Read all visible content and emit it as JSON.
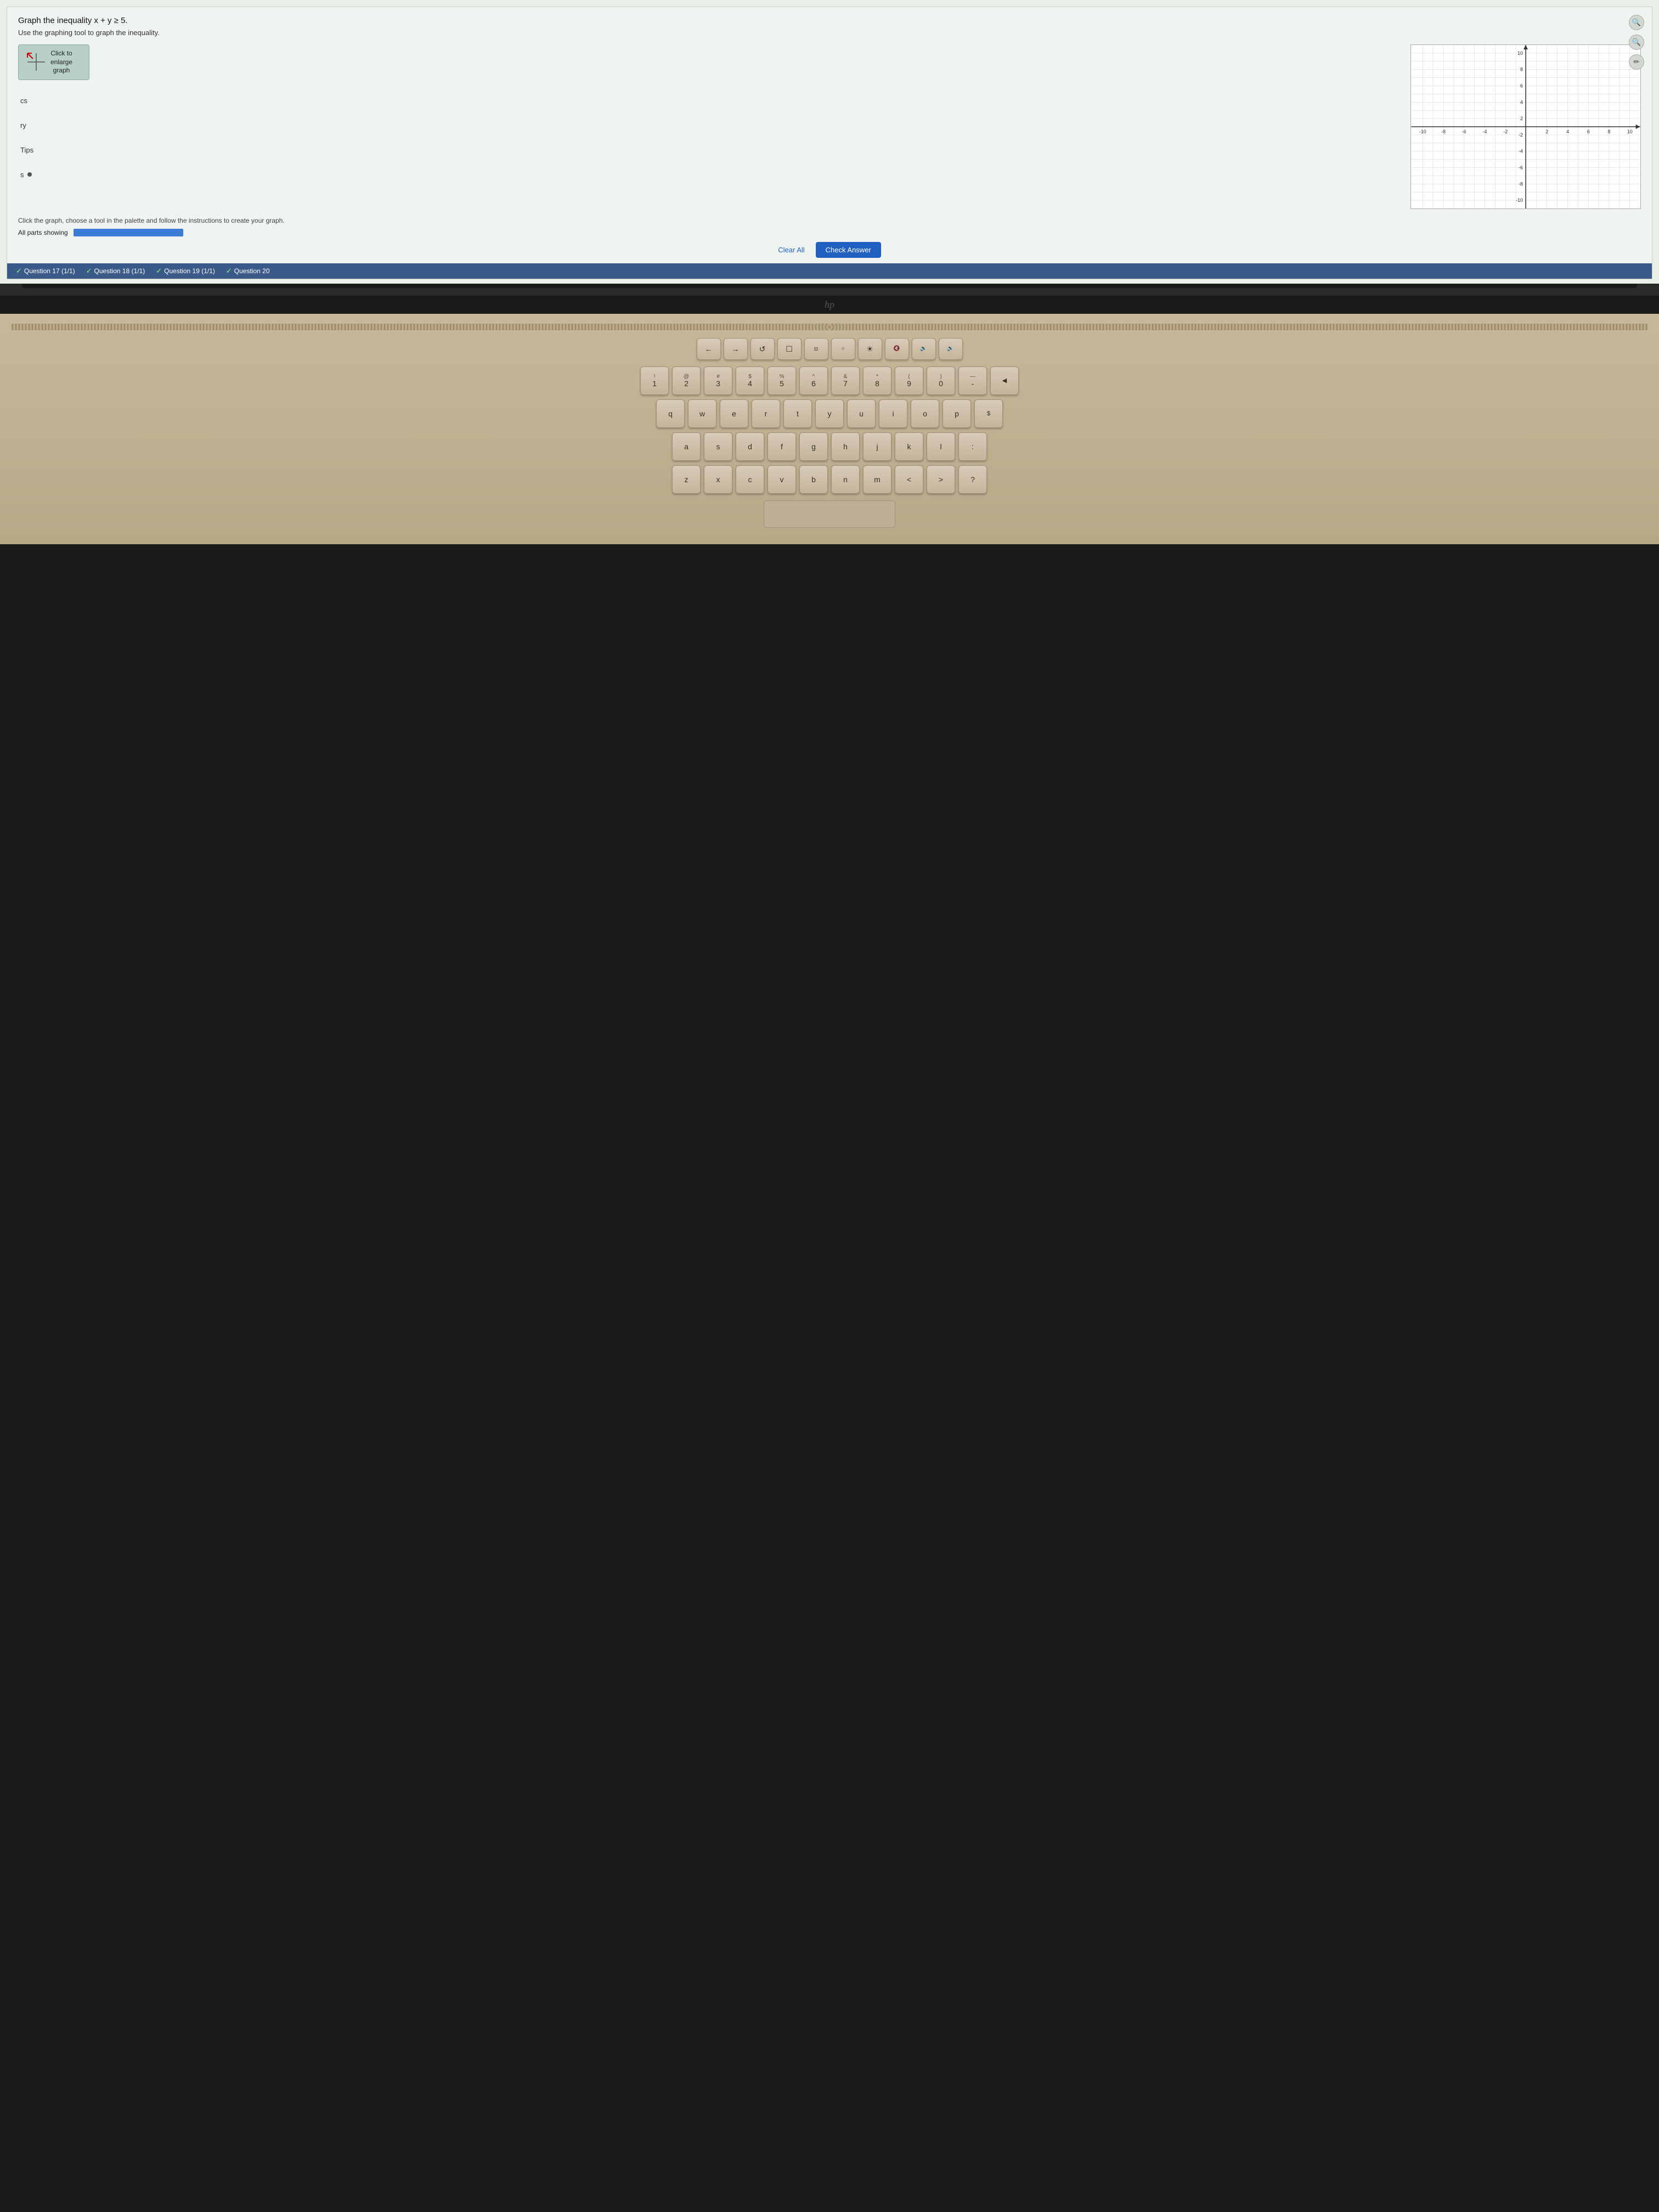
{
  "screen": {
    "problem_title": "Graph the inequality x + y ≥ 5.",
    "problem_subtitle": "Use the graphing tool to graph the inequality.",
    "enlarge_btn_label": "Click to enlarge graph",
    "enlarge_btn_short": "Click to\nenlarge\ngraph",
    "side_labels": [
      "ry",
      "Tips",
      "s"
    ],
    "instructions": "Click the graph, choose a tool in the palette and follow the instructions to create your graph.",
    "progress_label": "All parts showing",
    "clear_all": "Clear All",
    "check_answer": "Check Answer",
    "questions": [
      {
        "label": "Question 17 (1/1)",
        "check": true
      },
      {
        "label": "Question 18 (1/1)",
        "check": true
      },
      {
        "label": "Question 19 (1/1)",
        "check": true
      },
      {
        "label": "Question 20",
        "check": true
      }
    ],
    "graph": {
      "x_min": -10,
      "x_max": 10,
      "y_min": -10,
      "y_max": 10,
      "x_labels": [
        -10,
        -8,
        -6,
        -4,
        -2,
        2,
        4,
        6,
        8,
        10
      ],
      "y_labels": [
        10,
        8,
        6,
        4,
        2,
        -2,
        -4,
        -6,
        -8,
        -10
      ]
    }
  },
  "keyboard": {
    "row1_fn": [
      "←",
      "→",
      "↺",
      "☐",
      "⊞",
      "○",
      "☀",
      "◀◀",
      "▶⏸",
      "▶▶"
    ],
    "row2": [
      {
        "upper": "!",
        "lower": "1"
      },
      {
        "upper": "@",
        "lower": "2"
      },
      {
        "upper": "#",
        "lower": "3"
      },
      {
        "upper": "$",
        "lower": "4"
      },
      {
        "upper": "%",
        "lower": "5"
      },
      {
        "upper": "^",
        "lower": "6"
      },
      {
        "upper": "&",
        "lower": "7"
      },
      {
        "upper": "*",
        "lower": "8"
      },
      {
        "upper": "(",
        "lower": "9"
      },
      {
        "upper": ")",
        "lower": "0"
      },
      {
        "upper": "—",
        "lower": "-"
      },
      {
        "upper": "",
        "lower": "♪"
      }
    ],
    "row3": [
      "q",
      "w",
      "e",
      "r",
      "t",
      "y",
      "u",
      "i",
      "o",
      "p",
      "$"
    ],
    "row4": [
      "a",
      "s",
      "d",
      "f",
      "g",
      "h",
      "j",
      "k",
      "l",
      ":"
    ],
    "row5": [
      "z",
      "x",
      "c",
      "v",
      "b",
      "n",
      "m",
      "<",
      ">",
      "?"
    ]
  }
}
